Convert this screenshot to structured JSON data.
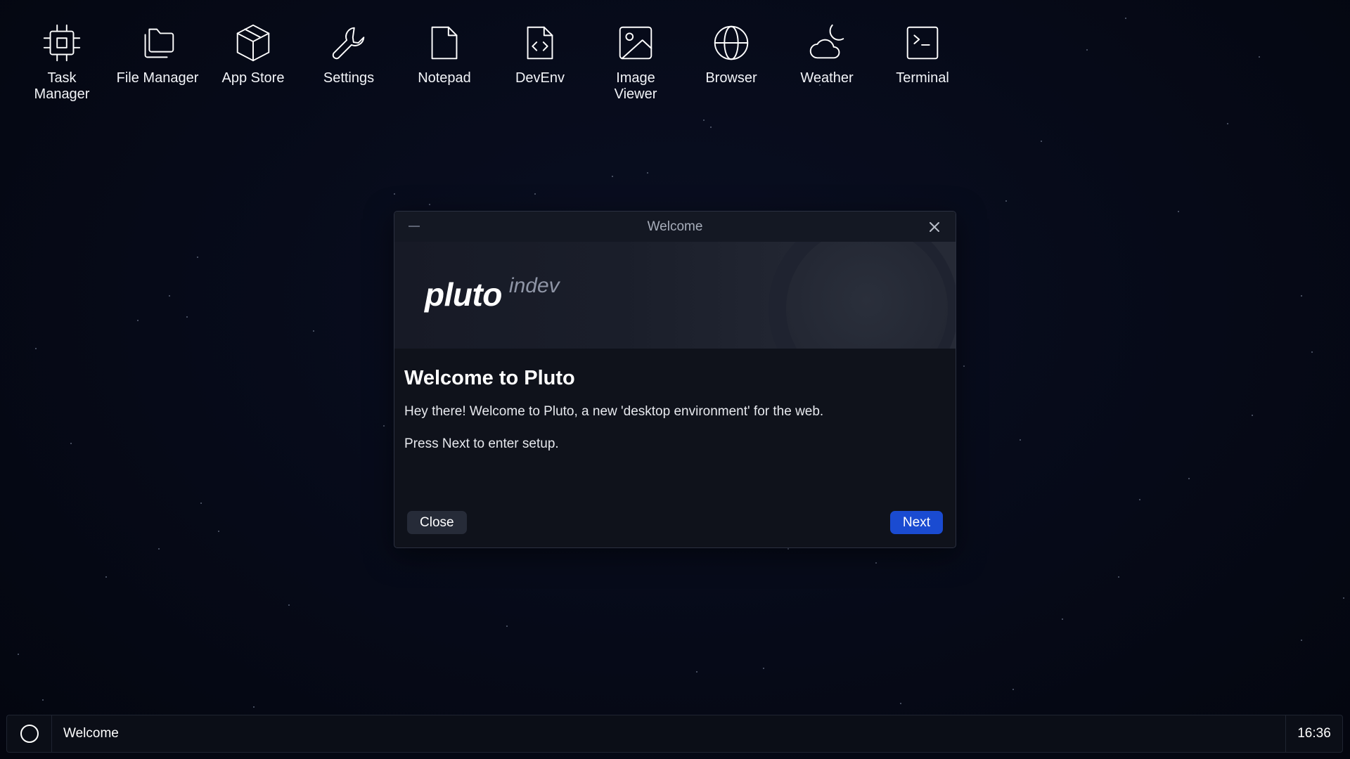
{
  "desktop": {
    "icons": [
      {
        "label": "Task Manager",
        "icon": "cpu-icon"
      },
      {
        "label": "File Manager",
        "icon": "folders-icon"
      },
      {
        "label": "App Store",
        "icon": "box-icon"
      },
      {
        "label": "Settings",
        "icon": "wrench-icon"
      },
      {
        "label": "Notepad",
        "icon": "file-icon"
      },
      {
        "label": "DevEnv",
        "icon": "file-code-icon"
      },
      {
        "label": "Image Viewer",
        "icon": "image-icon"
      },
      {
        "label": "Browser",
        "icon": "globe-icon"
      },
      {
        "label": "Weather",
        "icon": "cloud-moon-icon"
      },
      {
        "label": "Terminal",
        "icon": "terminal-icon"
      }
    ]
  },
  "window": {
    "title": "Welcome",
    "logo_text": "pluto",
    "logo_sub": "indev",
    "heading": "Welcome to Pluto",
    "paragraphs": [
      "Hey there! Welcome to Pluto, a new 'desktop environment' for the web.",
      "Press Next to enter setup."
    ],
    "close_label": "Close",
    "next_label": "Next"
  },
  "taskbar": {
    "start_icon": "circle-icon",
    "items": [
      {
        "label": "Welcome"
      }
    ],
    "clock": "16:36"
  },
  "colors": {
    "background": "#050814",
    "window": "#0f121b",
    "accent": "#1a4bd1",
    "secondary_button": "#262b38"
  }
}
